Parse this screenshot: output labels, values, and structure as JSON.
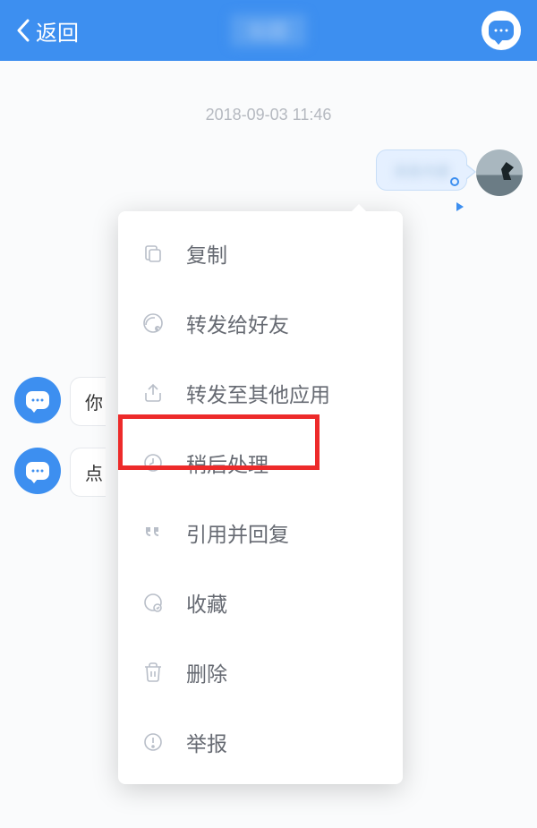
{
  "header": {
    "back_label": "返回",
    "title_blur": "标题"
  },
  "chat": {
    "timestamp": "2018-09-03 11:46",
    "outgoing_blur": "消息内容",
    "incoming_1_partial": "你",
    "incoming_2_partial": "点"
  },
  "menu": {
    "items": [
      {
        "label": "复制",
        "icon": "copy"
      },
      {
        "label": "转发给好友",
        "icon": "forward-friend"
      },
      {
        "label": "转发至其他应用",
        "icon": "share"
      },
      {
        "label": "稍后处理",
        "icon": "clock"
      },
      {
        "label": "引用并回复",
        "icon": "quote"
      },
      {
        "label": "收藏",
        "icon": "bookmark"
      },
      {
        "label": "删除",
        "icon": "trash"
      },
      {
        "label": "举报",
        "icon": "report"
      }
    ]
  }
}
